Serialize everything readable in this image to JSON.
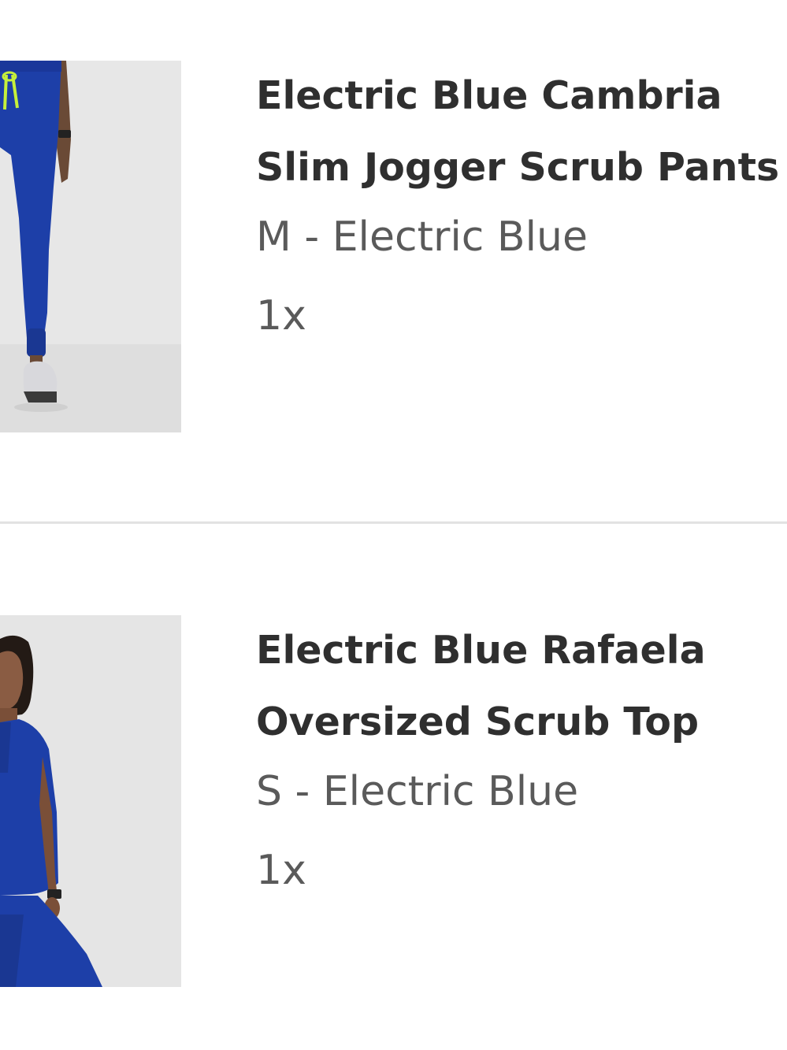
{
  "cart": {
    "items": [
      {
        "title_line1": "Electric Blue Cambria",
        "title_line2": "Slim Jogger Scrub Pants",
        "variant": "M - Electric Blue",
        "quantity": "1x",
        "image_icon": "product-photo-jogger-pants"
      },
      {
        "title_line1": "Electric Blue Rafaela",
        "title_line2": "Oversized Scrub Top",
        "variant": "S - Electric Blue",
        "quantity": "1x",
        "image_icon": "product-photo-scrub-top"
      }
    ]
  },
  "colors": {
    "product_blue": "#1d3fa8",
    "accent_lime": "#c6f03a",
    "photo_background": "#e6e6e6",
    "divider": "#e2e2e2"
  }
}
